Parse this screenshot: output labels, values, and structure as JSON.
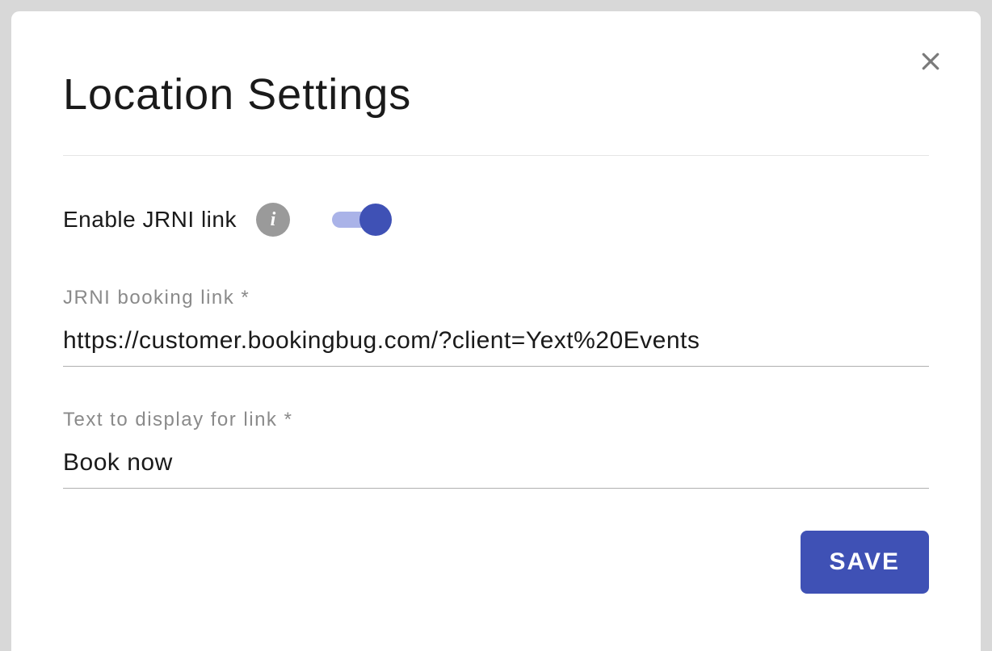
{
  "modal": {
    "title": "Location Settings",
    "enable_jrni_label": "Enable JRNI link",
    "toggle_on": true,
    "fields": {
      "booking_link": {
        "label": "JRNI booking link *",
        "value": "https://customer.bookingbug.com/?client=Yext%20Events"
      },
      "display_text": {
        "label": "Text to display for link *",
        "value": "Book now"
      }
    },
    "save_button_label": "SAVE"
  }
}
